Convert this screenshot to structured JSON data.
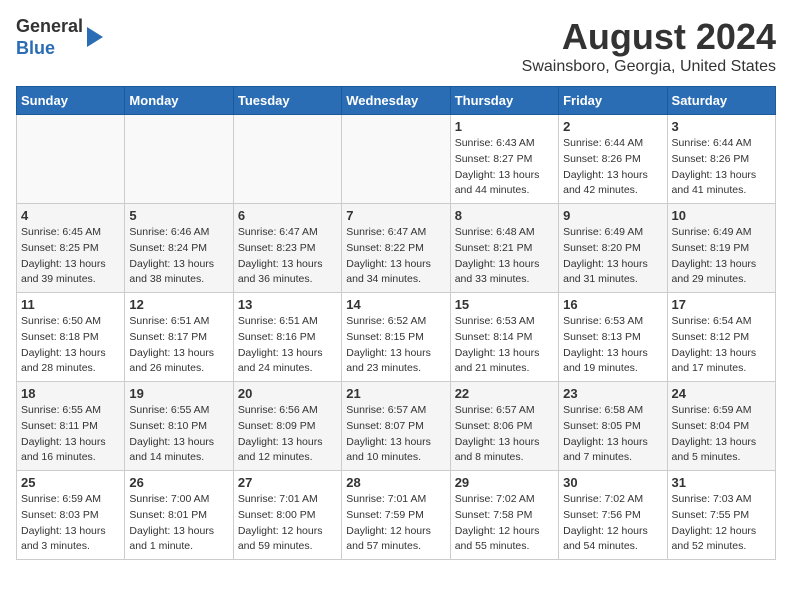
{
  "header": {
    "logo_line1": "General",
    "logo_line2": "Blue",
    "month_year": "August 2024",
    "location": "Swainsboro, Georgia, United States"
  },
  "days_of_week": [
    "Sunday",
    "Monday",
    "Tuesday",
    "Wednesday",
    "Thursday",
    "Friday",
    "Saturday"
  ],
  "weeks": [
    [
      {
        "day": "",
        "info": ""
      },
      {
        "day": "",
        "info": ""
      },
      {
        "day": "",
        "info": ""
      },
      {
        "day": "",
        "info": ""
      },
      {
        "day": "1",
        "info": "Sunrise: 6:43 AM\nSunset: 8:27 PM\nDaylight: 13 hours\nand 44 minutes."
      },
      {
        "day": "2",
        "info": "Sunrise: 6:44 AM\nSunset: 8:26 PM\nDaylight: 13 hours\nand 42 minutes."
      },
      {
        "day": "3",
        "info": "Sunrise: 6:44 AM\nSunset: 8:26 PM\nDaylight: 13 hours\nand 41 minutes."
      }
    ],
    [
      {
        "day": "4",
        "info": "Sunrise: 6:45 AM\nSunset: 8:25 PM\nDaylight: 13 hours\nand 39 minutes."
      },
      {
        "day": "5",
        "info": "Sunrise: 6:46 AM\nSunset: 8:24 PM\nDaylight: 13 hours\nand 38 minutes."
      },
      {
        "day": "6",
        "info": "Sunrise: 6:47 AM\nSunset: 8:23 PM\nDaylight: 13 hours\nand 36 minutes."
      },
      {
        "day": "7",
        "info": "Sunrise: 6:47 AM\nSunset: 8:22 PM\nDaylight: 13 hours\nand 34 minutes."
      },
      {
        "day": "8",
        "info": "Sunrise: 6:48 AM\nSunset: 8:21 PM\nDaylight: 13 hours\nand 33 minutes."
      },
      {
        "day": "9",
        "info": "Sunrise: 6:49 AM\nSunset: 8:20 PM\nDaylight: 13 hours\nand 31 minutes."
      },
      {
        "day": "10",
        "info": "Sunrise: 6:49 AM\nSunset: 8:19 PM\nDaylight: 13 hours\nand 29 minutes."
      }
    ],
    [
      {
        "day": "11",
        "info": "Sunrise: 6:50 AM\nSunset: 8:18 PM\nDaylight: 13 hours\nand 28 minutes."
      },
      {
        "day": "12",
        "info": "Sunrise: 6:51 AM\nSunset: 8:17 PM\nDaylight: 13 hours\nand 26 minutes."
      },
      {
        "day": "13",
        "info": "Sunrise: 6:51 AM\nSunset: 8:16 PM\nDaylight: 13 hours\nand 24 minutes."
      },
      {
        "day": "14",
        "info": "Sunrise: 6:52 AM\nSunset: 8:15 PM\nDaylight: 13 hours\nand 23 minutes."
      },
      {
        "day": "15",
        "info": "Sunrise: 6:53 AM\nSunset: 8:14 PM\nDaylight: 13 hours\nand 21 minutes."
      },
      {
        "day": "16",
        "info": "Sunrise: 6:53 AM\nSunset: 8:13 PM\nDaylight: 13 hours\nand 19 minutes."
      },
      {
        "day": "17",
        "info": "Sunrise: 6:54 AM\nSunset: 8:12 PM\nDaylight: 13 hours\nand 17 minutes."
      }
    ],
    [
      {
        "day": "18",
        "info": "Sunrise: 6:55 AM\nSunset: 8:11 PM\nDaylight: 13 hours\nand 16 minutes."
      },
      {
        "day": "19",
        "info": "Sunrise: 6:55 AM\nSunset: 8:10 PM\nDaylight: 13 hours\nand 14 minutes."
      },
      {
        "day": "20",
        "info": "Sunrise: 6:56 AM\nSunset: 8:09 PM\nDaylight: 13 hours\nand 12 minutes."
      },
      {
        "day": "21",
        "info": "Sunrise: 6:57 AM\nSunset: 8:07 PM\nDaylight: 13 hours\nand 10 minutes."
      },
      {
        "day": "22",
        "info": "Sunrise: 6:57 AM\nSunset: 8:06 PM\nDaylight: 13 hours\nand 8 minutes."
      },
      {
        "day": "23",
        "info": "Sunrise: 6:58 AM\nSunset: 8:05 PM\nDaylight: 13 hours\nand 7 minutes."
      },
      {
        "day": "24",
        "info": "Sunrise: 6:59 AM\nSunset: 8:04 PM\nDaylight: 13 hours\nand 5 minutes."
      }
    ],
    [
      {
        "day": "25",
        "info": "Sunrise: 6:59 AM\nSunset: 8:03 PM\nDaylight: 13 hours\nand 3 minutes."
      },
      {
        "day": "26",
        "info": "Sunrise: 7:00 AM\nSunset: 8:01 PM\nDaylight: 13 hours\nand 1 minute."
      },
      {
        "day": "27",
        "info": "Sunrise: 7:01 AM\nSunset: 8:00 PM\nDaylight: 12 hours\nand 59 minutes."
      },
      {
        "day": "28",
        "info": "Sunrise: 7:01 AM\nSunset: 7:59 PM\nDaylight: 12 hours\nand 57 minutes."
      },
      {
        "day": "29",
        "info": "Sunrise: 7:02 AM\nSunset: 7:58 PM\nDaylight: 12 hours\nand 55 minutes."
      },
      {
        "day": "30",
        "info": "Sunrise: 7:02 AM\nSunset: 7:56 PM\nDaylight: 12 hours\nand 54 minutes."
      },
      {
        "day": "31",
        "info": "Sunrise: 7:03 AM\nSunset: 7:55 PM\nDaylight: 12 hours\nand 52 minutes."
      }
    ]
  ]
}
